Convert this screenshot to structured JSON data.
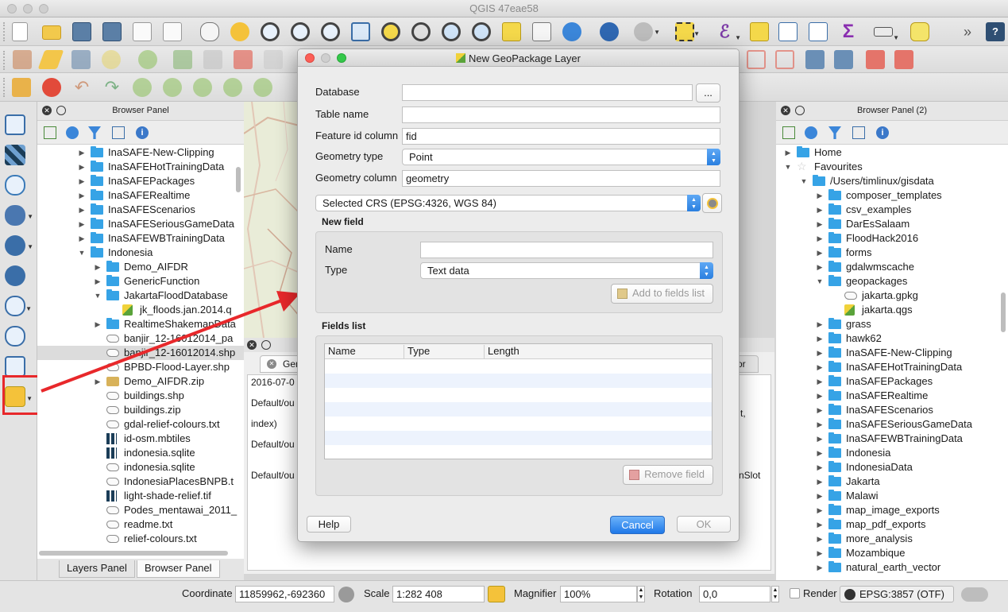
{
  "app": {
    "title": "QGIS 47eae58"
  },
  "toolbar_icons": [
    "new-project-icon",
    "open-project-icon",
    "save-project-icon",
    "save-as-icon",
    "new-print-layout-icon",
    "layout-manager-icon",
    "pan-icon",
    "pan-to-selection-icon",
    "zoom-in-icon",
    "zoom-out-icon",
    "zoom-native-icon",
    "zoom-full-icon",
    "zoom-to-selection-icon",
    "zoom-to-layer-icon",
    "zoom-last-icon",
    "zoom-next-icon",
    "new-bookmark-icon",
    "show-bookmarks-icon",
    "refresh-icon",
    "identify-icon",
    "action-icon",
    "select-icon",
    "deselect-icon",
    "expression-select-icon",
    "open-attribute-table-icon",
    "field-calculator-icon",
    "statistics-icon",
    "measure-icon",
    "annotation-icon",
    "help-icon"
  ],
  "left_panel": {
    "title": "Browser Panel",
    "items": [
      {
        "label": "InaSAFE-New-Clipping",
        "type": "folder",
        "indent": 1,
        "arrow": "right"
      },
      {
        "label": "InaSAFEHotTrainingData",
        "type": "folder",
        "indent": 1,
        "arrow": "right"
      },
      {
        "label": "InaSAFEPackages",
        "type": "folder",
        "indent": 1,
        "arrow": "right"
      },
      {
        "label": "InaSAFERealtime",
        "type": "folder",
        "indent": 1,
        "arrow": "right"
      },
      {
        "label": "InaSAFEScenarios",
        "type": "folder",
        "indent": 1,
        "arrow": "right"
      },
      {
        "label": "InaSAFESeriousGameData",
        "type": "folder",
        "indent": 1,
        "arrow": "right"
      },
      {
        "label": "InaSAFEWBTrainingData",
        "type": "folder",
        "indent": 1,
        "arrow": "right"
      },
      {
        "label": "Indonesia",
        "type": "folder",
        "indent": 1,
        "arrow": "down"
      },
      {
        "label": "Demo_AIFDR",
        "type": "folder",
        "indent": 2,
        "arrow": "right"
      },
      {
        "label": "GenericFunction",
        "type": "folder",
        "indent": 2,
        "arrow": "right"
      },
      {
        "label": "JakartaFloodDatabase",
        "type": "folder",
        "indent": 2,
        "arrow": "down"
      },
      {
        "label": "jk_floods.jan.2014.q",
        "type": "qgs",
        "indent": 3,
        "arrow": ""
      },
      {
        "label": "RealtimeShakemapData",
        "type": "folder",
        "indent": 2,
        "arrow": "right"
      },
      {
        "label": "banjir_12-16012014_pa",
        "type": "shape",
        "indent": 2,
        "arrow": ""
      },
      {
        "label": "banjir_12-16012014.shp",
        "type": "shape",
        "indent": 2,
        "arrow": "",
        "selected": true
      },
      {
        "label": "BPBD-Flood-Layer.shp",
        "type": "shape",
        "indent": 2,
        "arrow": ""
      },
      {
        "label": "Demo_AIFDR.zip",
        "type": "zip",
        "indent": 2,
        "arrow": "right"
      },
      {
        "label": "buildings.shp",
        "type": "shape",
        "indent": 2,
        "arrow": ""
      },
      {
        "label": "buildings.zip",
        "type": "shape",
        "indent": 2,
        "arrow": ""
      },
      {
        "label": "gdal-relief-colours.txt",
        "type": "shape",
        "indent": 2,
        "arrow": ""
      },
      {
        "label": "id-osm.mbtiles",
        "type": "grid",
        "indent": 2,
        "arrow": ""
      },
      {
        "label": "indonesia.sqlite",
        "type": "grid",
        "indent": 2,
        "arrow": ""
      },
      {
        "label": "indonesia.sqlite",
        "type": "shape",
        "indent": 2,
        "arrow": ""
      },
      {
        "label": "IndonesiaPlacesBNPB.t",
        "type": "shape",
        "indent": 2,
        "arrow": ""
      },
      {
        "label": "light-shade-relief.tif",
        "type": "grid",
        "indent": 2,
        "arrow": ""
      },
      {
        "label": "Podes_mentawai_2011_",
        "type": "shape",
        "indent": 2,
        "arrow": ""
      },
      {
        "label": "readme.txt",
        "type": "shape",
        "indent": 2,
        "arrow": ""
      },
      {
        "label": "relief-colours.txt",
        "type": "shape",
        "indent": 2,
        "arrow": ""
      }
    ]
  },
  "right_panel": {
    "title": "Browser Panel (2)",
    "items": [
      {
        "label": "Home",
        "type": "folder",
        "indent": 0,
        "arrow": "right"
      },
      {
        "label": "Favourites",
        "type": "star",
        "indent": 0,
        "arrow": "down"
      },
      {
        "label": "/Users/timlinux/gisdata",
        "type": "folder",
        "indent": 1,
        "arrow": "down"
      },
      {
        "label": "composer_templates",
        "type": "folder",
        "indent": 2,
        "arrow": "right"
      },
      {
        "label": "csv_examples",
        "type": "folder",
        "indent": 2,
        "arrow": "right"
      },
      {
        "label": "DarEsSalaam",
        "type": "folder",
        "indent": 2,
        "arrow": "right"
      },
      {
        "label": "FloodHack2016",
        "type": "folder",
        "indent": 2,
        "arrow": "right"
      },
      {
        "label": "forms",
        "type": "folder",
        "indent": 2,
        "arrow": "right"
      },
      {
        "label": "gdalwmscache",
        "type": "folder",
        "indent": 2,
        "arrow": "right"
      },
      {
        "label": "geopackages",
        "type": "folder",
        "indent": 2,
        "arrow": "down"
      },
      {
        "label": "jakarta.gpkg",
        "type": "shape",
        "indent": 3,
        "arrow": ""
      },
      {
        "label": "jakarta.qgs",
        "type": "qgs",
        "indent": 3,
        "arrow": ""
      },
      {
        "label": "grass",
        "type": "folder",
        "indent": 2,
        "arrow": "right"
      },
      {
        "label": "hawk62",
        "type": "folder",
        "indent": 2,
        "arrow": "right"
      },
      {
        "label": "InaSAFE-New-Clipping",
        "type": "folder",
        "indent": 2,
        "arrow": "right"
      },
      {
        "label": "InaSAFEHotTrainingData",
        "type": "folder",
        "indent": 2,
        "arrow": "right"
      },
      {
        "label": "InaSAFEPackages",
        "type": "folder",
        "indent": 2,
        "arrow": "right"
      },
      {
        "label": "InaSAFERealtime",
        "type": "folder",
        "indent": 2,
        "arrow": "right"
      },
      {
        "label": "InaSAFEScenarios",
        "type": "folder",
        "indent": 2,
        "arrow": "right"
      },
      {
        "label": "InaSAFESeriousGameData",
        "type": "folder",
        "indent": 2,
        "arrow": "right"
      },
      {
        "label": "InaSAFEWBTrainingData",
        "type": "folder",
        "indent": 2,
        "arrow": "right"
      },
      {
        "label": "Indonesia",
        "type": "folder",
        "indent": 2,
        "arrow": "right"
      },
      {
        "label": "IndonesiaData",
        "type": "folder",
        "indent": 2,
        "arrow": "right"
      },
      {
        "label": "Jakarta",
        "type": "folder",
        "indent": 2,
        "arrow": "right"
      },
      {
        "label": "Malawi",
        "type": "folder",
        "indent": 2,
        "arrow": "right"
      },
      {
        "label": "map_image_exports",
        "type": "folder",
        "indent": 2,
        "arrow": "right"
      },
      {
        "label": "map_pdf_exports",
        "type": "folder",
        "indent": 2,
        "arrow": "right"
      },
      {
        "label": "more_analysis",
        "type": "folder",
        "indent": 2,
        "arrow": "right"
      },
      {
        "label": "Mozambique",
        "type": "folder",
        "indent": 2,
        "arrow": "right"
      },
      {
        "label": "natural_earth_vector",
        "type": "folder",
        "indent": 2,
        "arrow": "right"
      }
    ]
  },
  "bottom_tabs": {
    "layers": "Layers Panel",
    "browser": "Browser Panel"
  },
  "log": {
    "tab_label": "Ger",
    "tab2_label": "or",
    "lines": [
      "2016-07-0",
      "Default/ou",
      "index)",
      "Default/ou",
      "Default/ou"
    ],
    "right_fragments": [
      "t,",
      "nSlot"
    ]
  },
  "status": {
    "coordinate_label": "Coordinate",
    "coordinate_value": "11859962,-692360",
    "scale_label": "Scale",
    "scale_value": "1:282 408",
    "magnifier_label": "Magnifier",
    "magnifier_value": "100%",
    "rotation_label": "Rotation",
    "rotation_value": "0,0",
    "render_label": "Render",
    "crs_label": "EPSG:3857 (OTF)"
  },
  "dialog": {
    "title": "New GeoPackage Layer",
    "database_label": "Database",
    "database_value": "",
    "browse_button": "...",
    "table_name_label": "Table name",
    "table_name_value": "",
    "feature_id_label": "Feature id column",
    "feature_id_value": "fid",
    "geometry_type_label": "Geometry type",
    "geometry_type_value": "Point",
    "geometry_column_label": "Geometry column",
    "geometry_column_value": "geometry",
    "crs_value": "Selected CRS (EPSG:4326, WGS 84)",
    "new_field_title": "New field",
    "name_label": "Name",
    "name_value": "",
    "type_label": "Type",
    "type_value": "Text data",
    "add_to_fields": "Add to fields list",
    "fields_list_title": "Fields list",
    "columns": [
      "Name",
      "Type",
      "Length"
    ],
    "remove_field": "Remove field",
    "help": "Help",
    "cancel": "Cancel",
    "ok": "OK"
  },
  "colors": {
    "accent": "#2a7fe0",
    "folder": "#36a3e6",
    "highlight": "#e8282b"
  }
}
